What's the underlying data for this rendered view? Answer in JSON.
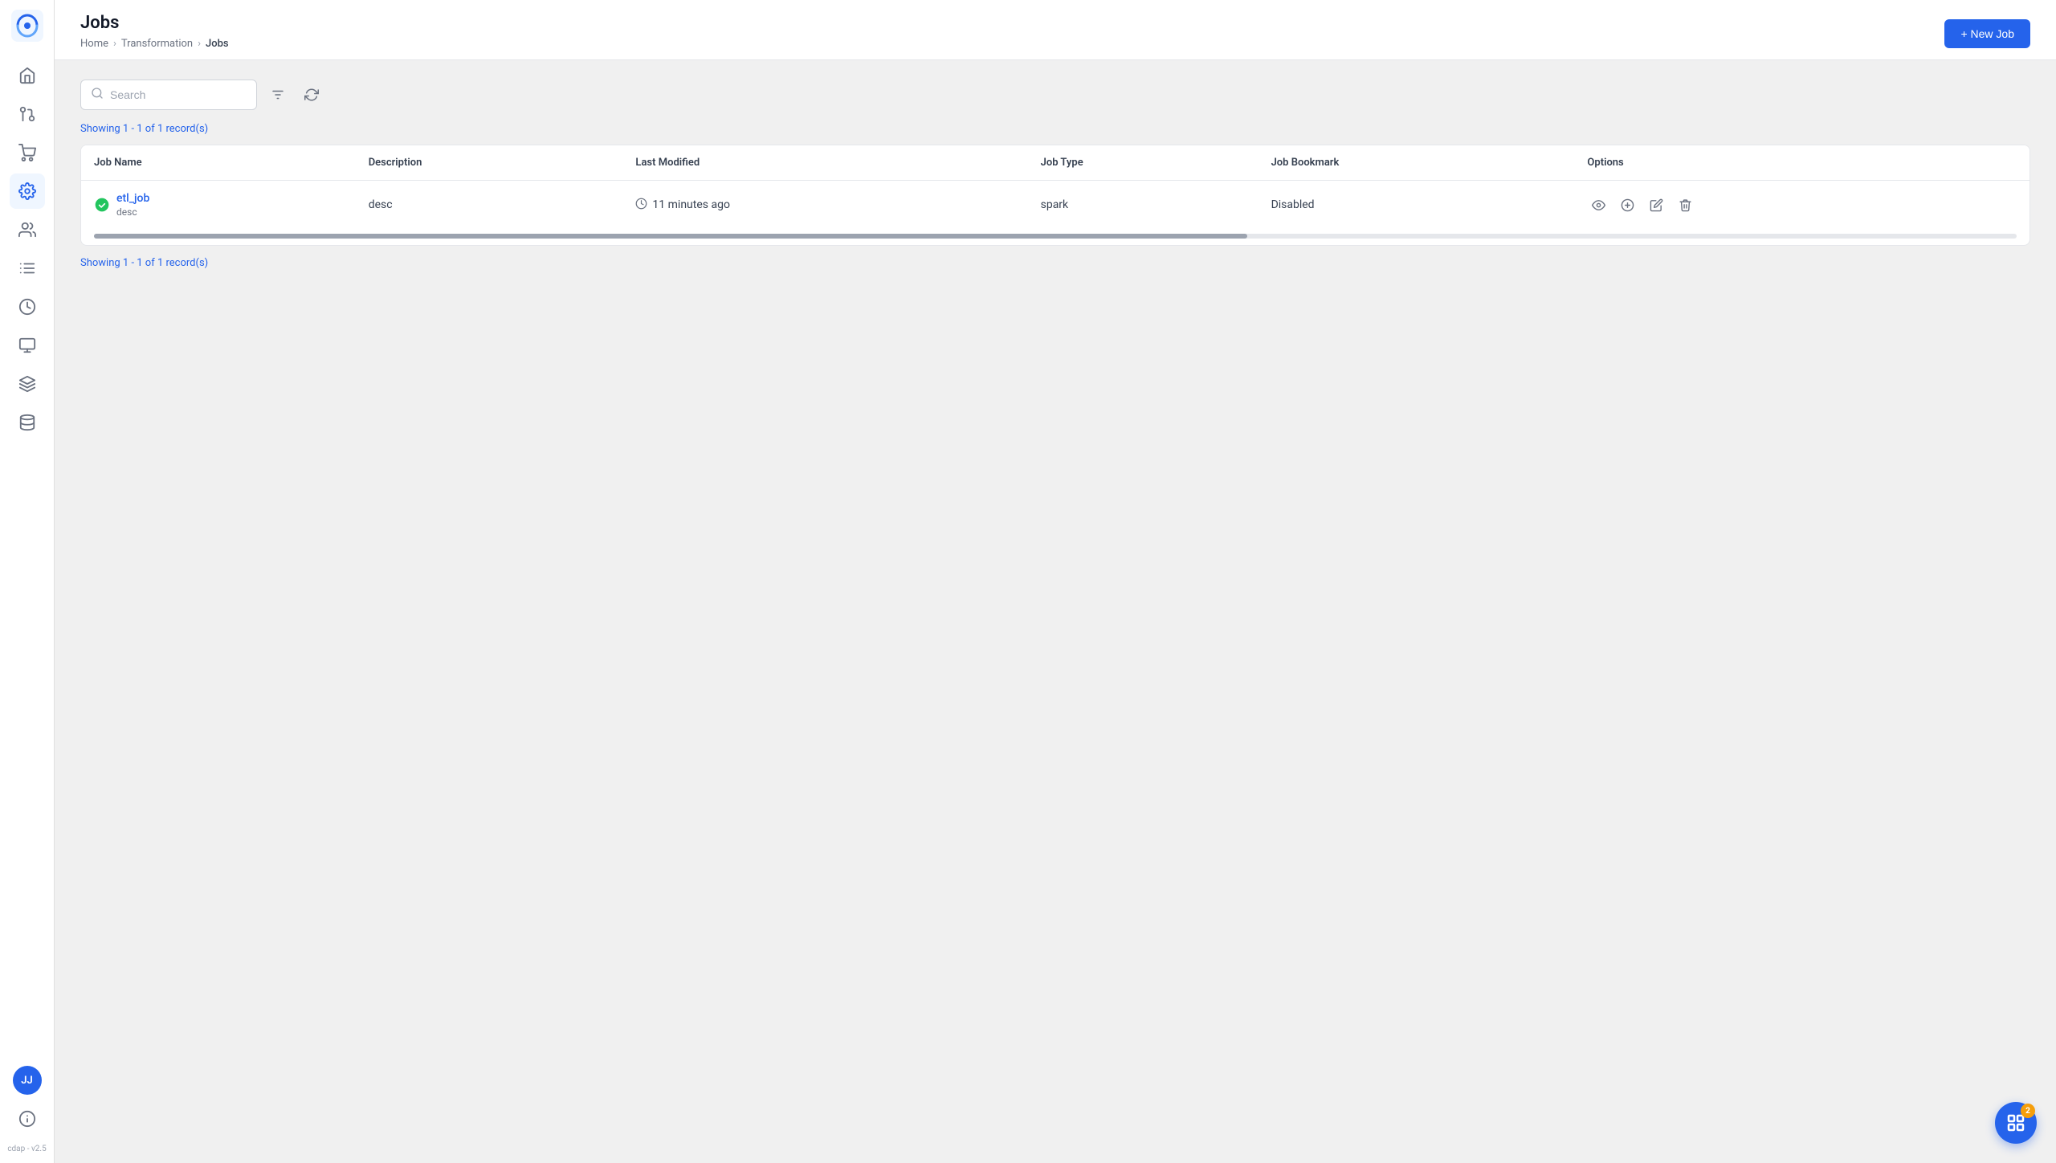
{
  "app": {
    "version": "cdap - v2.5",
    "logo_alt": "CDAP Logo"
  },
  "header": {
    "title": "Jobs",
    "new_job_label": "+ New Job",
    "breadcrumb": {
      "home": "Home",
      "transformation": "Transformation",
      "current": "Jobs"
    }
  },
  "search": {
    "placeholder": "Search"
  },
  "records": {
    "showing": "Showing 1 - 1 of 1 record(s)"
  },
  "table": {
    "columns": [
      "Job Name",
      "Description",
      "Last Modified",
      "Job Type",
      "Job Bookmark",
      "Options"
    ],
    "rows": [
      {
        "name": "etl_job",
        "description": "desc",
        "desc_sub": "desc",
        "last_modified": "11 minutes ago",
        "job_type": "spark",
        "job_bookmark": "Disabled",
        "status": "success"
      }
    ]
  },
  "sidebar": {
    "nav_items": [
      {
        "id": "home",
        "icon": "home"
      },
      {
        "id": "transform",
        "icon": "transform"
      },
      {
        "id": "group",
        "icon": "group"
      },
      {
        "id": "settings",
        "icon": "settings",
        "active": true
      },
      {
        "id": "users",
        "icon": "users"
      },
      {
        "id": "connections",
        "icon": "connections"
      },
      {
        "id": "clock",
        "icon": "clock"
      },
      {
        "id": "analytics",
        "icon": "analytics"
      },
      {
        "id": "layers",
        "icon": "layers"
      },
      {
        "id": "storage",
        "icon": "storage"
      }
    ],
    "user_initials": "JJ",
    "info_icon": "info"
  },
  "float_button": {
    "badge": "2"
  }
}
